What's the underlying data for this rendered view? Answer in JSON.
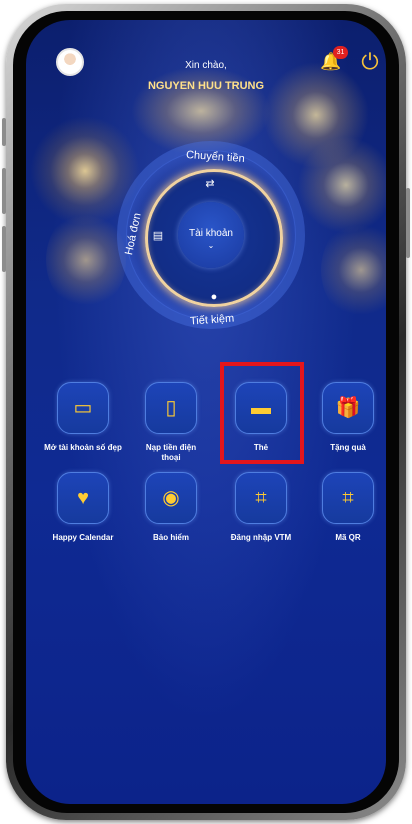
{
  "header": {
    "greeting": "Xin chào,",
    "user_name": "NGUYEN HUU TRUNG",
    "notification_count": "31"
  },
  "dial": {
    "center_label": "Tài khoản",
    "center_chevron": "⌄",
    "top_label": "Chuyển tiền",
    "bottom_label": "Tiết kiệm",
    "left_label": "Hoá đơn"
  },
  "tiles": [
    {
      "label": "Mở tài khoản số đẹp",
      "icon": "card-stack-icon",
      "glyph": "▭"
    },
    {
      "label": "Nạp tiền điện thoại",
      "icon": "phone-topup-icon",
      "glyph": "▯"
    },
    {
      "label": "Thẻ",
      "icon": "card-icon",
      "glyph": "▬"
    },
    {
      "label": "Tặng quà",
      "icon": "gift-icon",
      "glyph": "🎁"
    },
    {
      "label": "Happy Calendar",
      "icon": "calendar-heart-icon",
      "glyph": "♥"
    },
    {
      "label": "Bảo hiểm",
      "icon": "insurance-icon",
      "glyph": "◉"
    },
    {
      "label": "Đăng nhập VTM",
      "icon": "scan-login-icon",
      "glyph": "⌗"
    },
    {
      "label": "Mã QR",
      "icon": "qr-scan-icon",
      "glyph": "⌗"
    }
  ],
  "colors": {
    "accent": "#f6c23a",
    "highlight_border": "#e3161c",
    "background": "#0f2a8a"
  }
}
